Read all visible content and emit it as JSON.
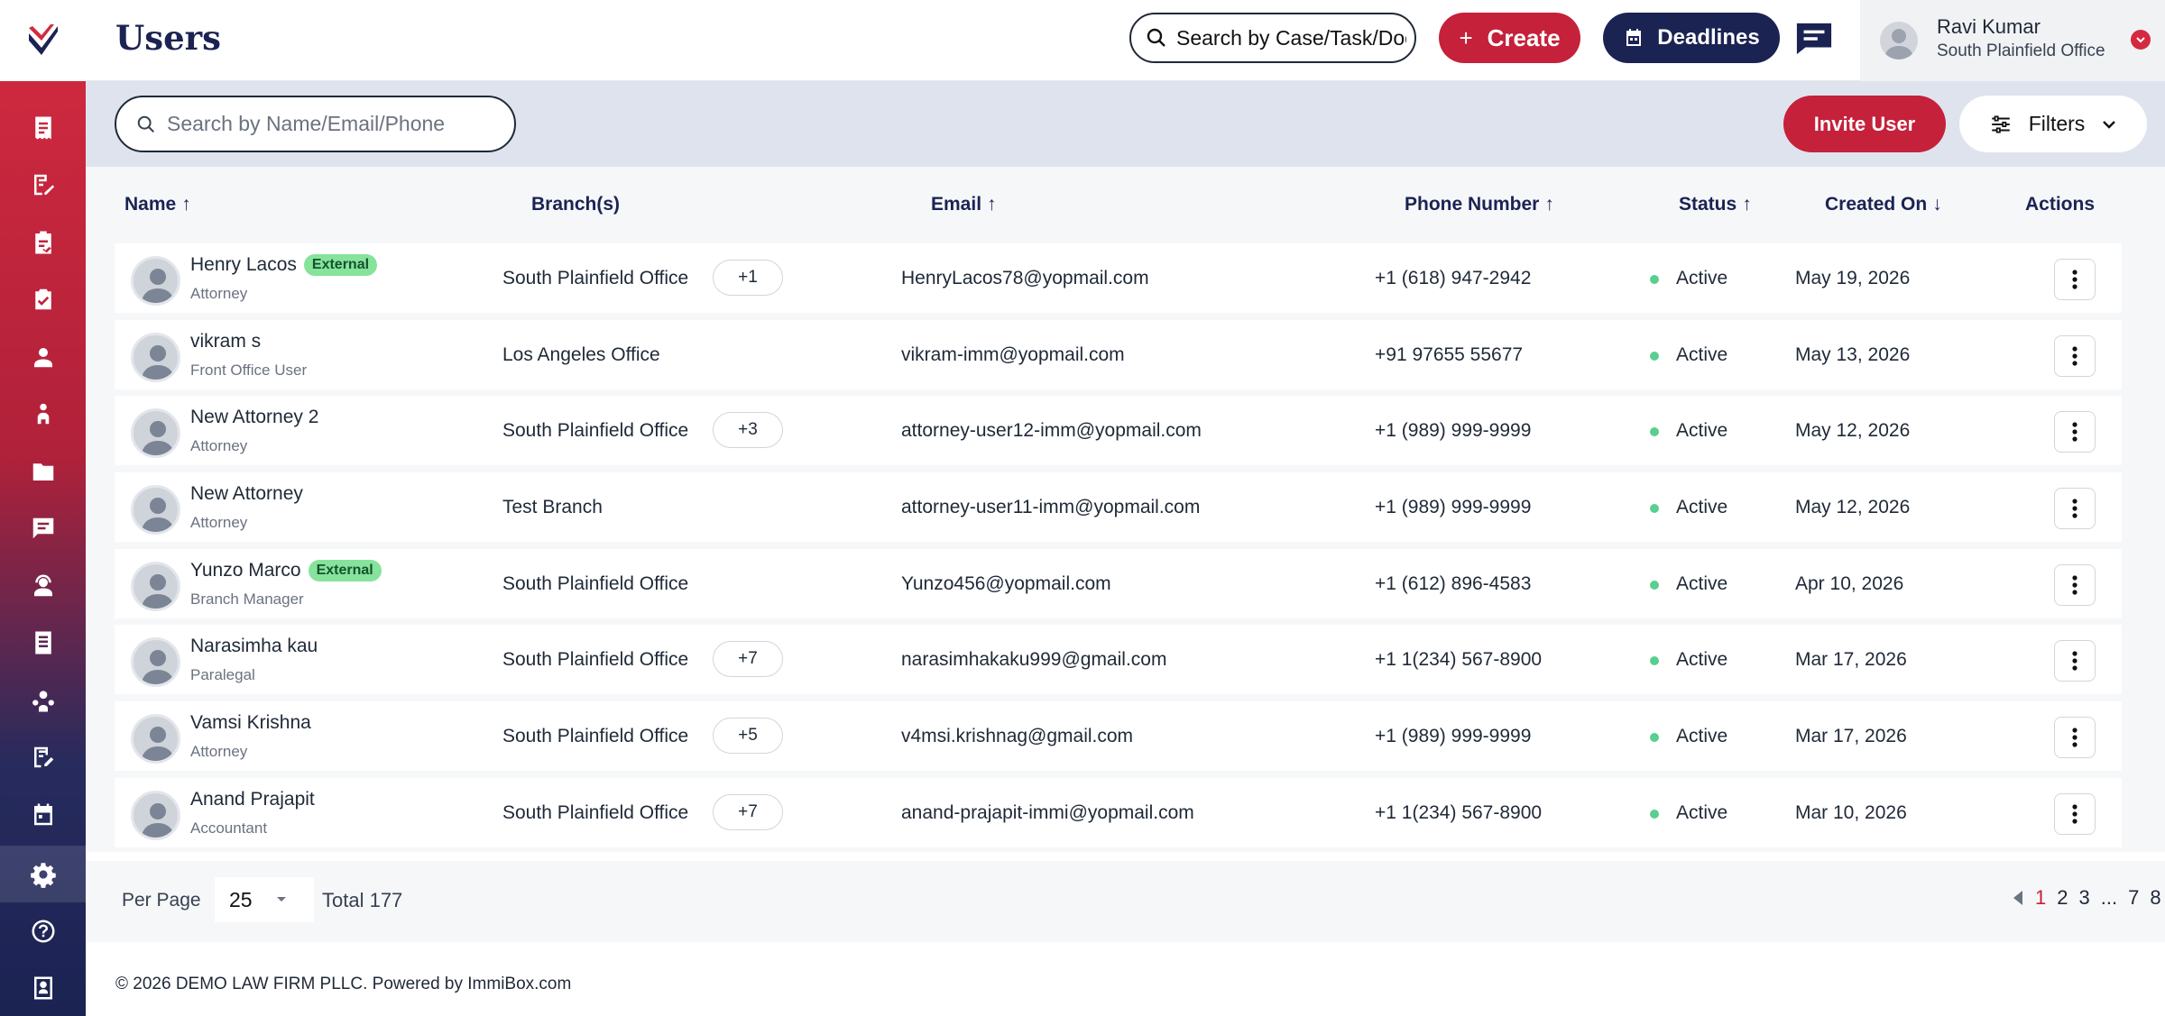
{
  "header": {
    "title": "Users",
    "search_placeholder": "Search by Case/Task/Document",
    "create_label": "Create",
    "deadlines_label": "Deadlines",
    "user_name": "Ravi Kumar",
    "user_office": "South Plainfield Office"
  },
  "sidebar": {
    "icons": [
      "receipt-icon",
      "edit-doc-icon",
      "clipboard-check-icon",
      "briefcase-icon",
      "user-icon",
      "team-icon",
      "folder-icon",
      "message-icon",
      "support-agent-icon",
      "document-icon",
      "users-gear-icon",
      "note-edit-icon",
      "calendar-icon",
      "settings-icon",
      "help-icon",
      "book-icon"
    ],
    "active": "settings-icon"
  },
  "toolbar": {
    "search_placeholder": "Search by Name/Email/Phone",
    "invite_label": "Invite User",
    "filters_label": "Filters"
  },
  "table": {
    "columns": {
      "name": "Name",
      "branch": "Branch(s)",
      "email": "Email",
      "phone": "Phone Number",
      "status": "Status",
      "created": "Created On",
      "actions": "Actions"
    },
    "rows": [
      {
        "name": "Henry Lacos",
        "badge": "External",
        "role": "Attorney",
        "branch": "South Plainfield Office",
        "more": "+1",
        "email": "HenryLacos78@yopmail.com",
        "phone": "+1 (618) 947-2942",
        "status": "Active",
        "created": "May 19, 2026"
      },
      {
        "name": "vikram s",
        "badge": "",
        "role": "Front Office User",
        "branch": "Los Angeles Office",
        "more": "",
        "email": "vikram-imm@yopmail.com",
        "phone": "+91  97655 55677",
        "status": "Active",
        "created": "May 13, 2026"
      },
      {
        "name": "New Attorney 2",
        "badge": "",
        "role": "Attorney",
        "branch": "South Plainfield Office",
        "more": "+3",
        "email": "attorney-user12-imm@yopmail.com",
        "phone": "+1 (989) 999-9999",
        "status": "Active",
        "created": "May 12, 2026"
      },
      {
        "name": "New Attorney",
        "badge": "",
        "role": "Attorney",
        "branch": "Test Branch",
        "more": "",
        "email": "attorney-user11-imm@yopmail.com",
        "phone": "+1 (989) 999-9999",
        "status": "Active",
        "created": "May 12, 2026"
      },
      {
        "name": "Yunzo Marco",
        "badge": "External",
        "role": "Branch Manager",
        "branch": "South Plainfield Office",
        "more": "",
        "email": "Yunzo456@yopmail.com",
        "phone": "+1 (612) 896-4583",
        "status": "Active",
        "created": "Apr 10, 2026"
      },
      {
        "name": "Narasimha kau",
        "badge": "",
        "role": "Paralegal",
        "branch": "South Plainfield Office",
        "more": "+7",
        "email": "narasimhakaku999@gmail.com",
        "phone": "+1 1(234) 567-8900",
        "status": "Active",
        "created": "Mar 17, 2026"
      },
      {
        "name": "Vamsi Krishna",
        "badge": "",
        "role": "Attorney",
        "branch": "South Plainfield Office",
        "more": "+5",
        "email": "v4msi.krishnag@gmail.com",
        "phone": "+1 (989) 999-9999",
        "status": "Active",
        "created": "Mar 17, 2026"
      },
      {
        "name": "Anand Prajapit",
        "badge": "",
        "role": "Accountant",
        "branch": "South Plainfield Office",
        "more": "+7",
        "email": "anand-prajapit-immi@yopmail.com",
        "phone": "+1 1(234) 567-8900",
        "status": "Active",
        "created": "Mar 10, 2026"
      }
    ]
  },
  "pagination": {
    "per_page_label": "Per Page",
    "per_page_value": "25",
    "total_label": "Total 177",
    "pages": [
      "1",
      "2",
      "3",
      "...",
      "7",
      "8"
    ],
    "current": "1"
  },
  "footer": {
    "text": "© 2026 DEMO LAW FIRM PLLC. Powered by ImmiBox.com"
  },
  "colors": {
    "brand_red": "#c5213a",
    "brand_navy": "#1b2353",
    "status_active": "#59cf8f",
    "badge_external": "#86e39b"
  }
}
